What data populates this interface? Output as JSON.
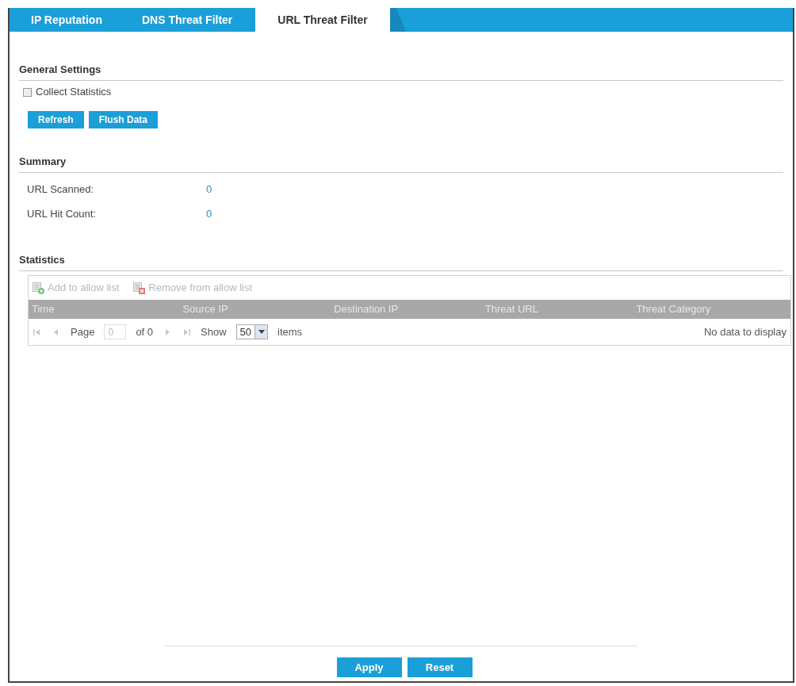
{
  "tabs": [
    {
      "label": "IP Reputation",
      "selected": false
    },
    {
      "label": "DNS Threat Filter",
      "selected": false
    },
    {
      "label": "URL Threat Filter",
      "selected": true
    }
  ],
  "general_settings": {
    "title": "General Settings",
    "collect_statistics": {
      "label": "Collect Statistics",
      "checked": false
    },
    "buttons": [
      "Refresh",
      "Flush Data"
    ]
  },
  "summary": {
    "title": "Summary",
    "rows": [
      {
        "label": "URL Scanned:",
        "value": "0"
      },
      {
        "label": "URL Hit Count:",
        "value": "0"
      }
    ]
  },
  "statistics": {
    "title": "Statistics",
    "toolbar": [
      {
        "kind": "add",
        "label": "Add to allow list",
        "disabled": true
      },
      {
        "kind": "remove",
        "label": "Remove from allow list",
        "disabled": true
      }
    ],
    "table": {
      "columns": [
        "Time",
        "Source IP",
        "Destination IP",
        "Threat URL",
        "Threat Category"
      ]
    },
    "pager": {
      "page_label": "Page",
      "page_value": "0",
      "of_label": "of 0",
      "show_label": "Show",
      "per_page": "50",
      "items_label": "items",
      "empty_message": "No data to display"
    }
  },
  "buttons": [
    "Apply",
    "Reset"
  ]
}
